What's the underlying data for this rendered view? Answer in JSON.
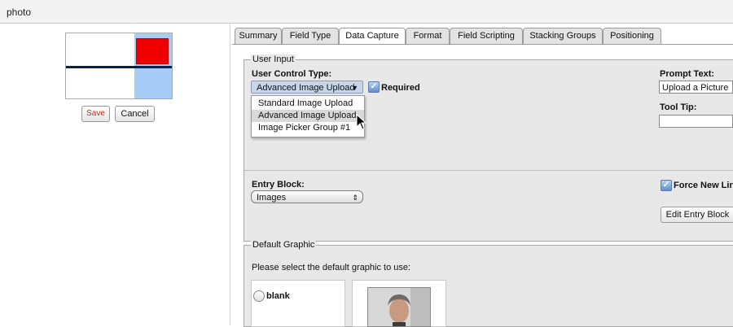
{
  "window": {
    "title": "photo"
  },
  "preview": {
    "save_label": "Save",
    "cancel_label": "Cancel"
  },
  "tabs": [
    {
      "label": "Summary",
      "active": false
    },
    {
      "label": "Field Type",
      "active": false
    },
    {
      "label": "Data Capture",
      "active": true
    },
    {
      "label": "Format",
      "active": false
    },
    {
      "label": "Field Scripting",
      "active": false
    },
    {
      "label": "Stacking Groups",
      "active": false
    },
    {
      "label": "Positioning",
      "active": false
    }
  ],
  "user_input": {
    "legend": "User Input",
    "control_type_label": "User Control Type:",
    "control_type_value": "Advanced Image Upload",
    "required_label": "Required",
    "required_checked": true,
    "options": [
      "Standard Image Upload",
      "Advanced Image Upload",
      "Image Picker Group #1"
    ],
    "highlighted_option": "Advanced Image Upload",
    "prompt_label": "Prompt Text:",
    "prompt_value": "Upload a Picture",
    "tooltip_label": "Tool Tip:",
    "tooltip_value": "",
    "entry_block_label": "Entry Block:",
    "entry_block_value": "Images",
    "force_new_line_label": "Force New Lin",
    "force_new_line_checked": true,
    "edit_entry_block_label": "Edit Entry Block"
  },
  "default_graphic": {
    "legend": "Default Graphic",
    "instruction": "Please select the default graphic to use:",
    "blank_label": "blank"
  },
  "colors": {
    "accent_red": "#ee0000",
    "preview_blue": "#a6cbf4",
    "preview_line": "#0b1f4e",
    "save_text": "#d4241c",
    "checkbox_blue": "#5d8fd1"
  }
}
